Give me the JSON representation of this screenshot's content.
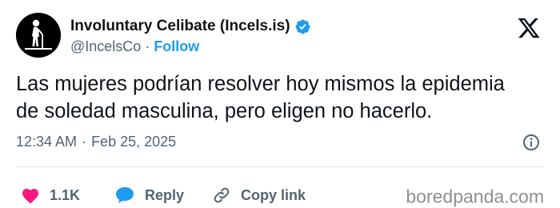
{
  "account": {
    "display_name": "Involuntary Celibate (Incels.is)",
    "handle": "@IncelsCo",
    "separator": "·",
    "follow_label": "Follow",
    "avatar_icon": "old-man-with-cane-icon",
    "verified_icon": "verified-badge-icon"
  },
  "platform": {
    "logo_icon": "x-logo-icon"
  },
  "tweet": {
    "lines": [
      "Las mujeres podrían resolver hoy mismos la epidemia",
      "de soledad masculina, pero eligen no hacerlo."
    ],
    "time": "12:34 AM",
    "meta_separator": "·",
    "date": "Feb 25, 2025",
    "info_icon": "info-icon"
  },
  "actions": {
    "like": {
      "icon": "heart-icon",
      "count": "1.1K"
    },
    "reply": {
      "icon": "speech-bubble-icon",
      "label": "Reply"
    },
    "copy_link": {
      "icon": "link-icon",
      "label": "Copy link"
    }
  },
  "watermark": "boredpanda.com",
  "colors": {
    "accent": "#1d9bf0",
    "like": "#f91880",
    "text": "#0f1419",
    "muted": "#536471"
  }
}
